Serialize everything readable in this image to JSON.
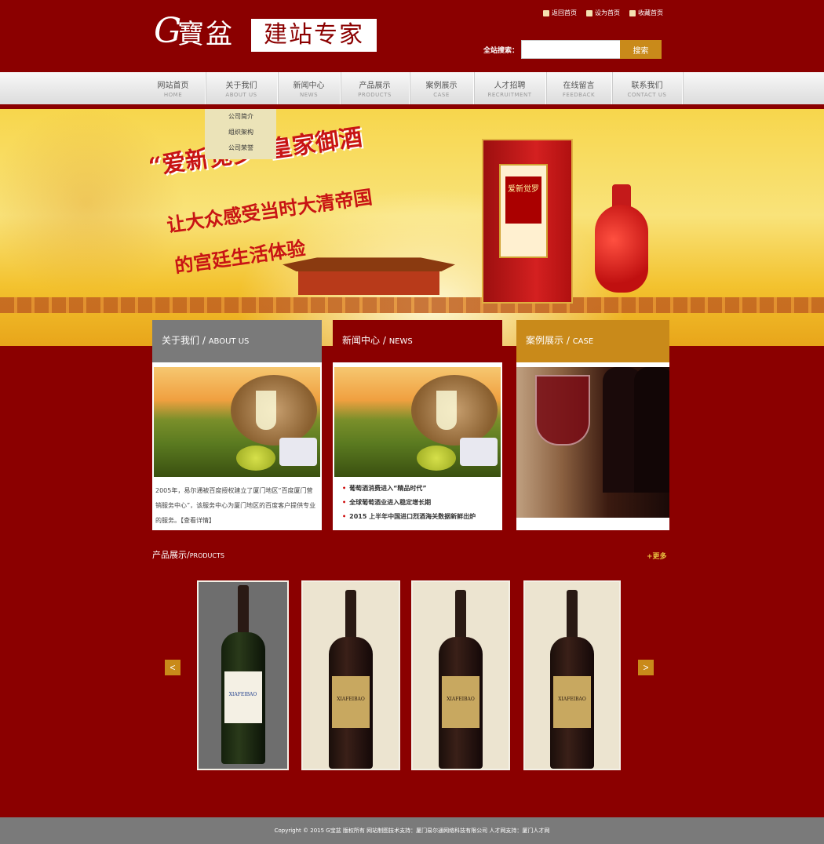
{
  "header": {
    "logo_g": "G",
    "logo_brand": "寶盆",
    "logo_slogan": "建站专家",
    "toplinks": [
      "返回首页",
      "设为首页",
      "收藏首页"
    ],
    "search_label": "全站搜索：",
    "search_placeholder": "",
    "search_button": "搜索"
  },
  "nav": [
    {
      "cn": "网站首页",
      "en": "HOME"
    },
    {
      "cn": "关于我们",
      "en": "ABOUT US"
    },
    {
      "cn": "新闻中心",
      "en": "NEWS"
    },
    {
      "cn": "产品展示",
      "en": "PRODUCTS"
    },
    {
      "cn": "案例展示",
      "en": "CASE"
    },
    {
      "cn": "人才招聘",
      "en": "RECRUITMENT"
    },
    {
      "cn": "在线留言",
      "en": "FEEDBACK"
    },
    {
      "cn": "联系我们",
      "en": "CONTACT US"
    }
  ],
  "dropdown": [
    "公司简介",
    "组织架构",
    "公司荣誉"
  ],
  "banner": {
    "title": "“爱新觉罗”皇家御酒",
    "line1": "让大众感受当时大清帝国",
    "line2": "的宫廷生活体验",
    "box_label": "爱新觉罗"
  },
  "about": {
    "title": "关于我们",
    "title_en": "ABOUT US",
    "text": "2005年，易尔通被百度授权建立了厦门地区“百度厦门营销服务中心”，该服务中心为厦门地区的百度客户提供专业的服务。【查看详情】",
    "color": "#7a7a7a"
  },
  "news": {
    "title": "新闻中心",
    "title_en": "NEWS",
    "items": [
      "葡萄酒消费进入“精品时代”",
      "全球葡萄酒业进入稳定增长期",
      "2015 上半年中国进口烈酒海关数据新鲜出炉"
    ],
    "color": "#8b0000"
  },
  "case": {
    "title": "案例展示",
    "title_en": "CASE",
    "color": "#c98a1a"
  },
  "products": {
    "title": "产品展示/",
    "title_en": "PRODUCTS",
    "more": "+更多",
    "prev": "<",
    "next": ">",
    "items": [
      {
        "label": "XIAFEIBAO"
      },
      {
        "label": "XIAFEIBAO"
      },
      {
        "label": "XIAFEIBAO"
      },
      {
        "label": "XIAFEIBAO"
      }
    ]
  },
  "footer": {
    "text": "Copyright © 2015 G宝盆 版权所有   网站制图技术支持：厦门易尔通网络科技有限公司 人才网支持：厦门人才网"
  }
}
